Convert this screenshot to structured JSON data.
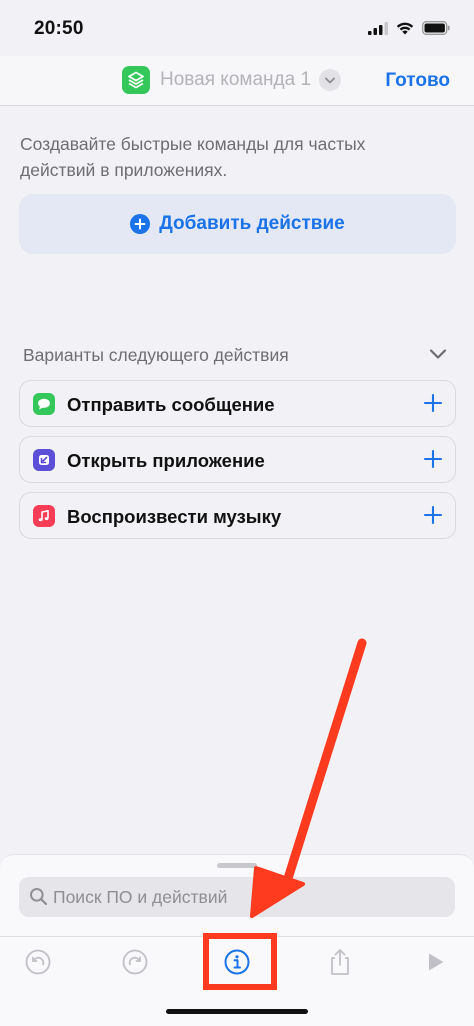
{
  "status_bar": {
    "time": "20:50"
  },
  "nav": {
    "title": "Новая команда 1",
    "done_label": "Готово"
  },
  "main": {
    "description": "Создавайте быстрые команды для частых действий в приложениях.",
    "add_action_label": "Добавить действие"
  },
  "suggestions": {
    "title": "Варианты следующего действия",
    "items": [
      {
        "label": "Отправить сообщение",
        "icon": "messages-icon",
        "color": "#34c759"
      },
      {
        "label": "Открыть приложение",
        "icon": "open-app-icon",
        "color": "#5b4fd8"
      },
      {
        "label": "Воспроизвести музыку",
        "icon": "music-icon",
        "color": "#fa3d56"
      }
    ]
  },
  "bottom_sheet": {
    "search_placeholder": "Поиск ПО и действий"
  },
  "colors": {
    "accent": "#1a73e8",
    "annotation": "#ff3b1f",
    "app_icon": "#34c759"
  }
}
